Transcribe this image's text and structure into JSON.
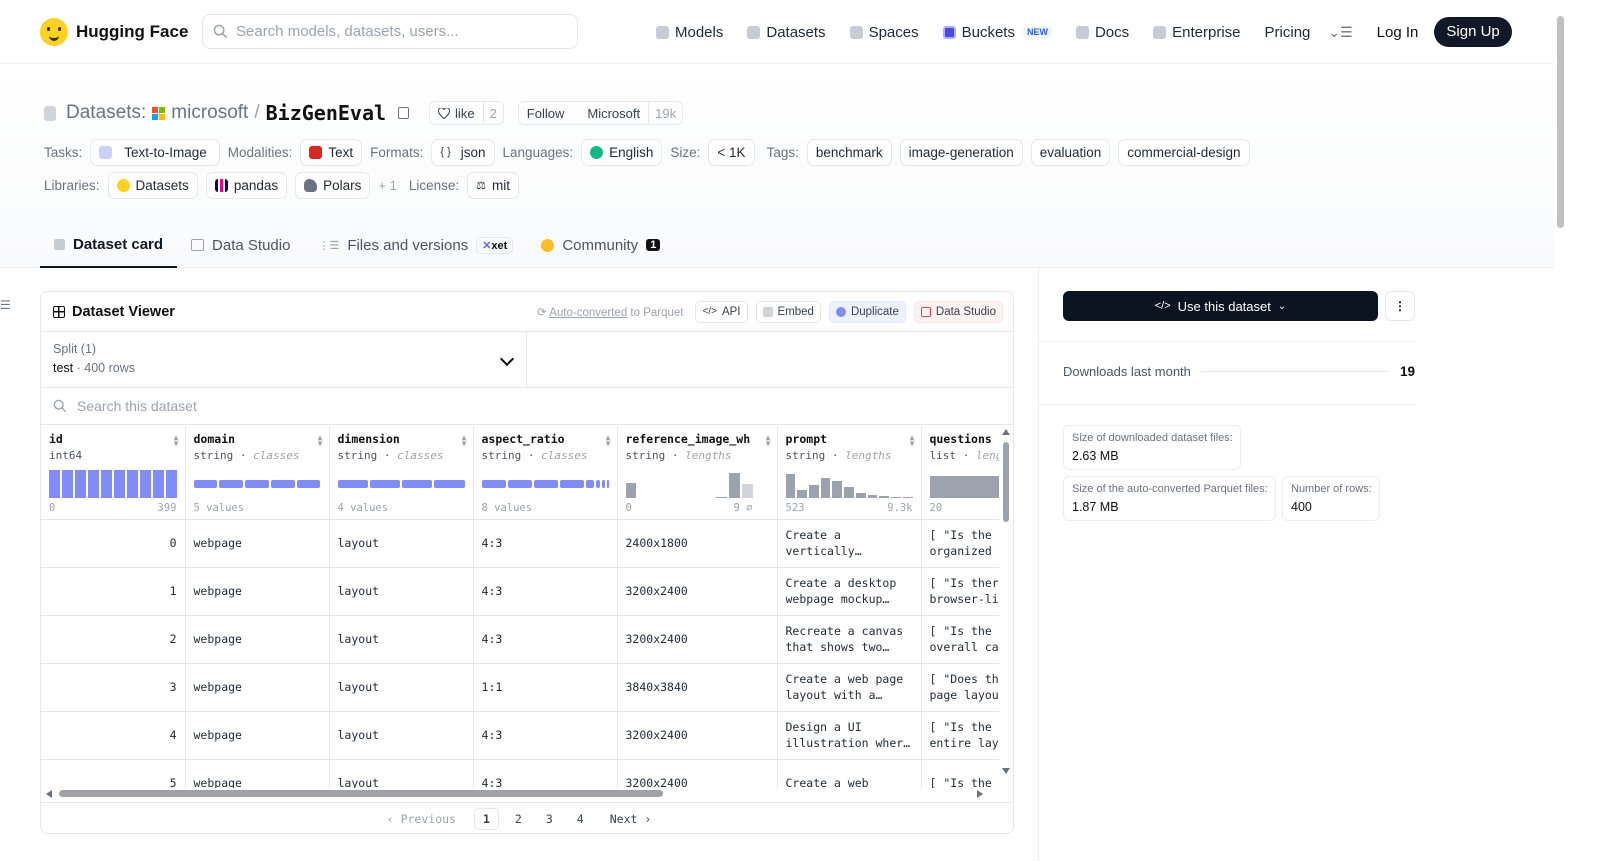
{
  "nav": {
    "brand": "Hugging Face",
    "search_placeholder": "Search models, datasets, users...",
    "links": [
      {
        "label": "Models",
        "icon": "cube-icon"
      },
      {
        "label": "Datasets",
        "icon": "database-icon"
      },
      {
        "label": "Spaces",
        "icon": "grid-icon"
      },
      {
        "label": "Buckets",
        "icon": "bucket-icon",
        "badge": "NEW"
      },
      {
        "label": "Docs",
        "icon": "book-icon"
      },
      {
        "label": "Enterprise",
        "icon": "enterprise-icon"
      },
      {
        "label": "Pricing"
      }
    ],
    "more_icon": "menu-more-icon",
    "login": "Log In",
    "signup": "Sign Up"
  },
  "repo": {
    "section": "Datasets:",
    "org": "microsoft",
    "slash": "/",
    "name": "BizGenEval",
    "like_label": "like",
    "like_count": "2",
    "follow_label": "Follow",
    "follow_org": "Microsoft",
    "follow_count": "19k"
  },
  "meta": {
    "tasks_label": "Tasks:",
    "task": "Text-to-Image",
    "modalities_label": "Modalities:",
    "modality": "Text",
    "formats_label": "Formats:",
    "format": "json",
    "languages_label": "Languages:",
    "language": "English",
    "size_label": "Size:",
    "size": "< 1K",
    "tags_label": "Tags:",
    "tags": [
      "benchmark",
      "image-generation",
      "evaluation",
      "commercial-design"
    ],
    "libraries_label": "Libraries:",
    "libraries": [
      "Datasets",
      "pandas",
      "Polars"
    ],
    "libraries_more": "+ 1",
    "license_label": "License:",
    "license": "mit"
  },
  "tabs": {
    "card": "Dataset card",
    "studio": "Data Studio",
    "files": "Files and versions",
    "xet": "xet",
    "community": "Community",
    "community_count": "1"
  },
  "viewer": {
    "title": "Dataset Viewer",
    "auto_converted": "Auto-converted",
    "to_parquet": " to Parquet",
    "api": "API",
    "embed": "Embed",
    "duplicate": "Duplicate",
    "data_studio": "Data Studio",
    "split_label": "Split (1)",
    "split_name": "test",
    "split_sep": " · ",
    "split_rows": "400 rows",
    "search_placeholder": "Search this dataset",
    "columns": [
      {
        "name": "id",
        "type": "int64",
        "kind": "",
        "min": "0",
        "max": "399"
      },
      {
        "name": "domain",
        "type": "string",
        "kind": "classes",
        "min": "5 values",
        "max": ""
      },
      {
        "name": "dimension",
        "type": "string",
        "kind": "classes",
        "min": "4 values",
        "max": ""
      },
      {
        "name": "aspect_ratio",
        "type": "string",
        "kind": "classes",
        "min": "8 values",
        "max": ""
      },
      {
        "name": "reference_image_wh",
        "type": "string",
        "kind": "lengths",
        "min": "0",
        "max": "9 ⌀"
      },
      {
        "name": "prompt",
        "type": "string",
        "kind": "lengths",
        "min": "523",
        "max": "9.3k"
      },
      {
        "name": "questions",
        "type": "list",
        "kind": "lengths",
        "min": "20",
        "max": ""
      }
    ],
    "rows": [
      {
        "id": "0",
        "domain": "webpage",
        "dimension": "layout",
        "aspect_ratio": "4:3",
        "wh": "2400x1800",
        "prompt": "Create a vertically…",
        "questions": "[ \"Is the\norganized"
      },
      {
        "id": "1",
        "domain": "webpage",
        "dimension": "layout",
        "aspect_ratio": "4:3",
        "wh": "3200x2400",
        "prompt": "Create a desktop webpage mockup…",
        "questions": "[ \"Is ther\nbrowser-li"
      },
      {
        "id": "2",
        "domain": "webpage",
        "dimension": "layout",
        "aspect_ratio": "4:3",
        "wh": "3200x2400",
        "prompt": "Recreate a canvas that shows two…",
        "questions": "[ \"Is the\noverall ca"
      },
      {
        "id": "3",
        "domain": "webpage",
        "dimension": "layout",
        "aspect_ratio": "1:1",
        "wh": "3840x3840",
        "prompt": "Create a web page layout with a…",
        "questions": "[ \"Does th\npage layou"
      },
      {
        "id": "4",
        "domain": "webpage",
        "dimension": "layout",
        "aspect_ratio": "4:3",
        "wh": "3200x2400",
        "prompt": "Design a UI illustration wher…",
        "questions": "[ \"Is the\nentire lay"
      },
      {
        "id": "5",
        "domain": "webpage",
        "dimension": "layout",
        "aspect_ratio": "4:3",
        "wh": "3200x2400",
        "prompt": "Create a web",
        "questions": "[ \"Is the"
      }
    ],
    "pager": {
      "prev": "Previous",
      "pages": [
        "1",
        "2",
        "3",
        "4"
      ],
      "current": "1",
      "next": "Next"
    }
  },
  "sidebar": {
    "use_dataset": "Use this dataset",
    "downloads_label": "Downloads last month",
    "downloads_value": "19",
    "size_downloaded_label": "Size of downloaded dataset files:",
    "size_downloaded_value": "2.63 MB",
    "size_parquet_label": "Size of the auto-converted Parquet files:",
    "size_parquet_value": "1.87 MB",
    "num_rows_label": "Number of rows:",
    "num_rows_value": "400"
  },
  "colors": {
    "accent_indigo": "#818cf8",
    "dark_button": "#0b1220",
    "brand_yellow": "#ffd21e"
  }
}
